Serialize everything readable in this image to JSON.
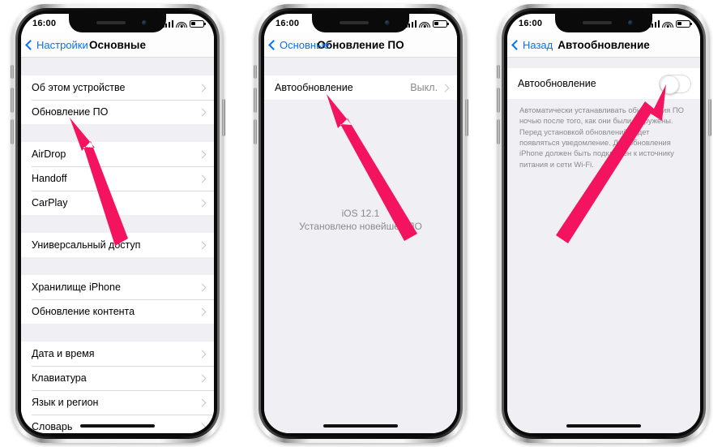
{
  "meta": {
    "accent_blue": "#0a72ef",
    "arrow_color": "#f4135f",
    "list_bg": "#efeff4",
    "separator": "#d9d9de"
  },
  "status_bar": {
    "time": "16:00",
    "signal_icon": "cellular-signal-icon",
    "wifi_icon": "wifi-icon",
    "battery_icon": "battery-icon"
  },
  "phones": [
    {
      "id": "phone-general-settings",
      "nav": {
        "back_label": "Настройки",
        "title": "Основные",
        "back_icon": "chevron-left-icon"
      },
      "groups": [
        {
          "rows": [
            {
              "label": "Об этом устройстве",
              "value": "",
              "accessory": "chevron-right-icon"
            },
            {
              "label": "Обновление ПО",
              "value": "",
              "accessory": "chevron-right-icon"
            }
          ]
        },
        {
          "rows": [
            {
              "label": "AirDrop",
              "value": "",
              "accessory": "chevron-right-icon"
            },
            {
              "label": "Handoff",
              "value": "",
              "accessory": "chevron-right-icon"
            },
            {
              "label": "CarPlay",
              "value": "",
              "accessory": "chevron-right-icon"
            }
          ]
        },
        {
          "rows": [
            {
              "label": "Универсальный доступ",
              "value": "",
              "accessory": "chevron-right-icon"
            }
          ]
        },
        {
          "rows": [
            {
              "label": "Хранилище iPhone",
              "value": "",
              "accessory": "chevron-right-icon"
            },
            {
              "label": "Обновление контента",
              "value": "",
              "accessory": "chevron-right-icon"
            }
          ]
        },
        {
          "rows": [
            {
              "label": "Дата и время",
              "value": "",
              "accessory": "chevron-right-icon"
            },
            {
              "label": "Клавиатура",
              "value": "",
              "accessory": "chevron-right-icon"
            },
            {
              "label": "Язык и регион",
              "value": "",
              "accessory": "chevron-right-icon"
            },
            {
              "label": "Словарь",
              "value": "",
              "accessory": "chevron-right-icon"
            }
          ]
        }
      ],
      "annotation": {
        "type": "arrow",
        "points_to": "Обновление ПО"
      }
    },
    {
      "id": "phone-software-update",
      "nav": {
        "back_label": "Основные",
        "title": "Обновление ПО",
        "back_icon": "chevron-left-icon"
      },
      "groups": [
        {
          "rows": [
            {
              "label": "Автообновление",
              "value": "Выкл.",
              "accessory": "chevron-right-icon"
            }
          ]
        }
      ],
      "center_message": {
        "version": "iOS 12.1",
        "subtitle": "Установлено новейшее ПО"
      },
      "annotation": {
        "type": "arrow",
        "points_to": "Автообновление"
      }
    },
    {
      "id": "phone-auto-update",
      "nav": {
        "back_label": "Назад",
        "title": "Автообновление",
        "back_icon": "chevron-left-icon"
      },
      "toggle_row": {
        "label": "Автообновление",
        "state": "off",
        "accessory": "toggle-switch"
      },
      "footnote": "Автоматически устанавливать обновления ПО ночью после того, как они были загружены. Перед установкой обновлений будет появляться уведомление. Для обновления iPhone должен быть подключен к источнику питания и сети Wi-Fi.",
      "annotation": {
        "type": "arrow",
        "points_to": "Автообновление toggle"
      }
    }
  ]
}
